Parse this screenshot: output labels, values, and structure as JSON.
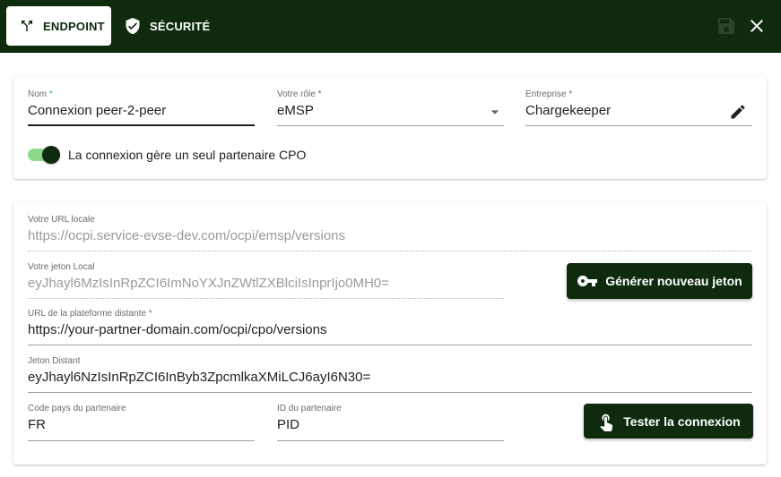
{
  "tabs": {
    "endpoint": {
      "label": "ENDPOINT",
      "icon": "split-arrows-icon"
    },
    "security": {
      "label": "SÉCURITÉ",
      "icon": "shield-check-icon"
    }
  },
  "toolbar": {
    "save_icon": "save-icon",
    "close_icon": "close-icon"
  },
  "connection": {
    "name": {
      "label": "Nom",
      "required_mark": "*",
      "value": "Connexion peer-2-peer"
    },
    "role": {
      "label": "Votre rôle *",
      "value": "eMSP"
    },
    "company": {
      "label": "Entreprise *",
      "value": "Chargekeeper"
    },
    "single_partner_toggle": {
      "label": "La connexion gère un seul partenaire CPO",
      "checked": true
    }
  },
  "endpoint": {
    "local_url": {
      "label": "Votre URL locale",
      "value": "https://ocpi.service-evse-dev.com/ocpi/emsp/versions"
    },
    "local_token": {
      "label": "Votre jeton Local",
      "value": "eyJhayl6MzIsInRpZCI6ImNoYXJnZWtlZXBlciIsInprIjo0MH0="
    },
    "generate_button": "Générer nouveau jeton",
    "remote_url": {
      "label": "URL de la plateforme distante *",
      "value": "https://your-partner-domain.com/ocpi/cpo/versions"
    },
    "remote_token": {
      "label": "Jeton Distant",
      "value": "eyJhayl6NzIsInRpZCI6InByb3ZpcmlkaXMiLCJ6ayI6N30="
    },
    "country_code": {
      "label": "Code pays du partenaire",
      "value": "FR"
    },
    "party_id": {
      "label": "ID du partenaire",
      "value": "PID"
    },
    "test_button": "Tester la connexion"
  },
  "colors": {
    "primary": "#0e2b0e",
    "toggle_track": "#8fd98f",
    "required": "#4caf50"
  }
}
